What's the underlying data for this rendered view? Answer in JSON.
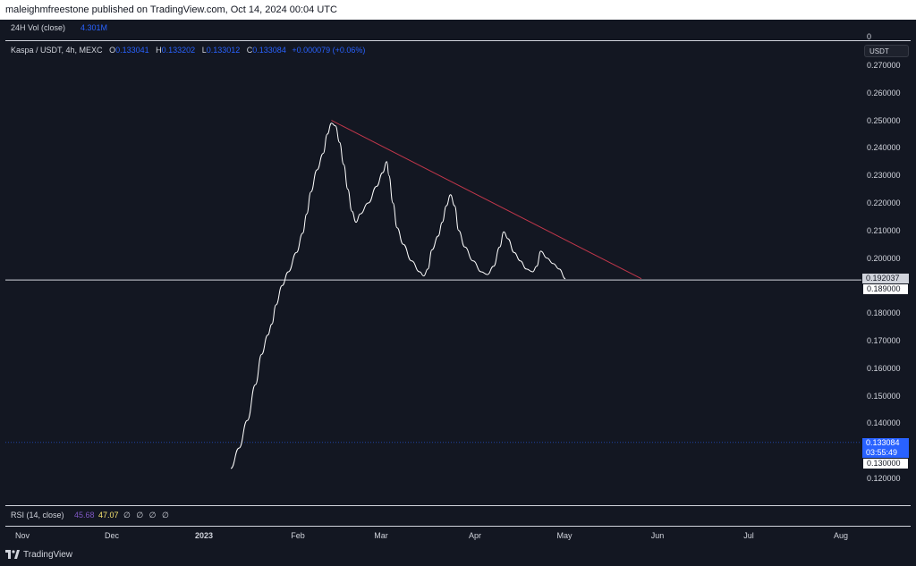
{
  "header": {
    "publisher_text": "maleighmfreestone published on TradingView.com, Oct 14, 2024 00:04 UTC"
  },
  "volume_pane": {
    "label": "24H Vol (close)",
    "value": "4.301M",
    "zero_label": "0"
  },
  "legend": {
    "symbol": "Kaspa / USDT, 4h, MEXC",
    "o_key": "O",
    "o_val": "0.133041",
    "h_key": "H",
    "h_val": "0.133202",
    "l_key": "L",
    "l_val": "0.133012",
    "c_key": "C",
    "c_val": "0.133084",
    "change": "+0.000079 (+0.06%)"
  },
  "price_axis": {
    "unit_button": "USDT",
    "labels": [
      "0.270000",
      "0.260000",
      "0.250000",
      "0.240000",
      "0.230000",
      "0.220000",
      "0.210000",
      "0.200000",
      "0.180000",
      "0.170000",
      "0.160000",
      "0.150000",
      "0.140000",
      "0.120000"
    ],
    "horizontal_level_label": "0.192037",
    "level_label_2": "0.189000",
    "last_price_label": "0.133084",
    "countdown_label": "03:55:49",
    "level_label_3": "0.130000"
  },
  "rsi_pane": {
    "label": "RSI (14, close)",
    "value1": "45.68",
    "value2": "47.07",
    "na_values": "∅ ∅ ∅ ∅"
  },
  "time_axis": {
    "labels": [
      "Nov",
      "Dec",
      "2023",
      "Feb",
      "Mar",
      "Apr",
      "May",
      "Jun",
      "Jul",
      "Aug"
    ],
    "bold_label": "2023"
  },
  "footer": {
    "brand": "TradingView"
  },
  "colors": {
    "background": "#131722",
    "price_line": "#ffffff",
    "trendline": "#c2374b",
    "horizontal_line": "#d1d4dc",
    "last_price": "#2962ff",
    "rsi_value": "#7e57c2",
    "rsi_ma": "#f7e46f"
  },
  "chart_data": {
    "type": "line",
    "series": [
      {
        "values": [
          [
            0.0,
            0.1236
          ],
          [
            0.02,
            0.131
          ],
          [
            0.04,
            0.141
          ],
          [
            0.06,
            0.154
          ],
          [
            0.075,
            0.165
          ],
          [
            0.09,
            0.172
          ],
          [
            0.1,
            0.176
          ],
          [
            0.11,
            0.183
          ],
          [
            0.125,
            0.19
          ],
          [
            0.14,
            0.195
          ],
          [
            0.16,
            0.202
          ],
          [
            0.175,
            0.209
          ],
          [
            0.185,
            0.216
          ],
          [
            0.195,
            0.224
          ],
          [
            0.21,
            0.232
          ],
          [
            0.225,
            0.238
          ],
          [
            0.235,
            0.245
          ],
          [
            0.245,
            0.249
          ],
          [
            0.255,
            0.248
          ],
          [
            0.265,
            0.242
          ],
          [
            0.275,
            0.234
          ],
          [
            0.285,
            0.225
          ],
          [
            0.295,
            0.217
          ],
          [
            0.305,
            0.213
          ],
          [
            0.315,
            0.216
          ],
          [
            0.335,
            0.22
          ],
          [
            0.355,
            0.226
          ],
          [
            0.37,
            0.231
          ],
          [
            0.38,
            0.235
          ],
          [
            0.385,
            0.23
          ],
          [
            0.395,
            0.22
          ],
          [
            0.405,
            0.211
          ],
          [
            0.42,
            0.205
          ],
          [
            0.44,
            0.199
          ],
          [
            0.46,
            0.195
          ],
          [
            0.47,
            0.1935
          ],
          [
            0.48,
            0.196
          ],
          [
            0.49,
            0.203
          ],
          [
            0.505,
            0.208
          ],
          [
            0.515,
            0.213
          ],
          [
            0.525,
            0.219
          ],
          [
            0.535,
            0.223
          ],
          [
            0.545,
            0.219
          ],
          [
            0.555,
            0.21
          ],
          [
            0.57,
            0.204
          ],
          [
            0.59,
            0.199
          ],
          [
            0.61,
            0.195
          ],
          [
            0.625,
            0.194
          ],
          [
            0.64,
            0.197
          ],
          [
            0.655,
            0.204
          ],
          [
            0.665,
            0.2095
          ],
          [
            0.675,
            0.207
          ],
          [
            0.69,
            0.202
          ],
          [
            0.705,
            0.199
          ],
          [
            0.72,
            0.196
          ],
          [
            0.735,
            0.195
          ],
          [
            0.745,
            0.197
          ],
          [
            0.755,
            0.2025
          ],
          [
            0.77,
            0.2
          ],
          [
            0.785,
            0.198
          ],
          [
            0.8,
            0.196
          ],
          [
            0.815,
            0.1925
          ]
        ]
      }
    ],
    "trendline": {
      "start": [
        0.245,
        0.25
      ],
      "end": [
        1.0,
        0.1925
      ]
    },
    "horizontal_level": 0.192037,
    "ylim": [
      0.115,
      0.285
    ],
    "grid": false
  }
}
